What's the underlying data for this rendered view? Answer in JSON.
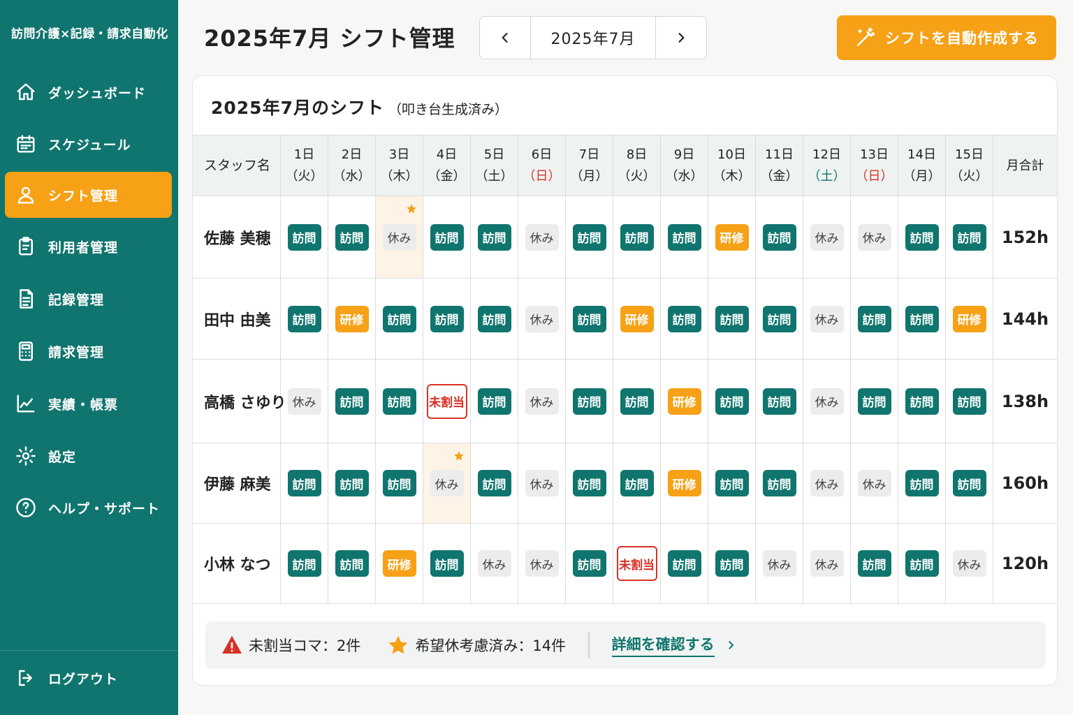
{
  "app": {
    "brand": "訪問介護×記録・請求自動化"
  },
  "sidebar": {
    "items": [
      {
        "label": "ダッシュボード",
        "icon": "home-icon"
      },
      {
        "label": "スケジュール",
        "icon": "calendar-icon"
      },
      {
        "label": "シフト管理",
        "icon": "user-icon",
        "active": true
      },
      {
        "label": "利用者管理",
        "icon": "clipboard-icon"
      },
      {
        "label": "記録管理",
        "icon": "document-icon"
      },
      {
        "label": "請求管理",
        "icon": "calculator-icon"
      },
      {
        "label": "実績・帳票",
        "icon": "chart-line-icon"
      },
      {
        "label": "設定",
        "icon": "gear-icon"
      },
      {
        "label": "ヘルプ・サポート",
        "icon": "help-icon"
      }
    ],
    "logout": {
      "label": "ログアウト",
      "icon": "logout-icon"
    }
  },
  "header": {
    "title": "2025年7月 シフト管理",
    "month_label": "2025年7月",
    "auto_button_label": "シフトを自動作成する"
  },
  "shift_table": {
    "title": "2025年7月のシフト",
    "subtitle": "（叩き台生成済み）",
    "name_header": "スタッフ名",
    "total_header": "月合計",
    "days": [
      {
        "day": "1日",
        "weekday": "（火）",
        "type": "weekday"
      },
      {
        "day": "2日",
        "weekday": "（水）",
        "type": "weekday"
      },
      {
        "day": "3日",
        "weekday": "（木）",
        "type": "weekday"
      },
      {
        "day": "4日",
        "weekday": "（金）",
        "type": "weekday"
      },
      {
        "day": "5日",
        "weekday": "（土）",
        "type": "weekday"
      },
      {
        "day": "6日",
        "weekday": "（日）",
        "type": "sun"
      },
      {
        "day": "7日",
        "weekday": "（月）",
        "type": "weekday"
      },
      {
        "day": "8日",
        "weekday": "（火）",
        "type": "weekday"
      },
      {
        "day": "9日",
        "weekday": "（水）",
        "type": "weekday"
      },
      {
        "day": "10日",
        "weekday": "（木）",
        "type": "weekday"
      },
      {
        "day": "11日",
        "weekday": "（金）",
        "type": "weekday"
      },
      {
        "day": "12日",
        "weekday": "（土）",
        "type": "sat"
      },
      {
        "day": "13日",
        "weekday": "（日）",
        "type": "sun"
      },
      {
        "day": "14日",
        "weekday": "（月）",
        "type": "weekday"
      },
      {
        "day": "15日",
        "weekday": "（火）",
        "type": "weekday"
      }
    ],
    "staff": [
      {
        "name": "佐藤 美穂",
        "total": "152h",
        "shifts": [
          "訪問",
          "訪問",
          "休み",
          "訪問",
          "訪問",
          "休み",
          "訪問",
          "訪問",
          "訪問",
          "研修",
          "訪問",
          "休み",
          "休み",
          "訪問",
          "訪問"
        ],
        "requested_off_days": [
          2
        ]
      },
      {
        "name": "田中 由美",
        "total": "144h",
        "shifts": [
          "訪問",
          "研修",
          "訪問",
          "訪問",
          "訪問",
          "休み",
          "訪問",
          "研修",
          "訪問",
          "訪問",
          "訪問",
          "休み",
          "訪問",
          "訪問",
          "研修"
        ],
        "requested_off_days": []
      },
      {
        "name": "高橋 さゆり",
        "total": "138h",
        "shifts": [
          "休み",
          "訪問",
          "訪問",
          "未割当",
          "訪問",
          "休み",
          "訪問",
          "訪問",
          "研修",
          "訪問",
          "訪問",
          "休み",
          "訪問",
          "訪問",
          "訪問"
        ],
        "requested_off_days": []
      },
      {
        "name": "伊藤 麻美",
        "total": "160h",
        "shifts": [
          "訪問",
          "訪問",
          "訪問",
          "休み",
          "訪問",
          "休み",
          "訪問",
          "訪問",
          "研修",
          "訪問",
          "訪問",
          "休み",
          "休み",
          "訪問",
          "訪問"
        ],
        "requested_off_days": [
          3
        ]
      },
      {
        "name": "小林 なつ",
        "total": "120h",
        "shifts": [
          "訪問",
          "訪問",
          "研修",
          "訪問",
          "休み",
          "休み",
          "訪問",
          "未割当",
          "訪問",
          "訪問",
          "休み",
          "休み",
          "訪問",
          "訪問",
          "休み"
        ],
        "requested_off_days": []
      }
    ]
  },
  "summary": {
    "unassigned": "未割当コマ：2件",
    "requests": "希望休考慮済み：14件",
    "details_link": "詳細を確認する"
  },
  "colors": {
    "primary": "#0f756e",
    "accent": "#f6a116",
    "danger": "#d93025",
    "highlight": "#fdf3e6"
  }
}
